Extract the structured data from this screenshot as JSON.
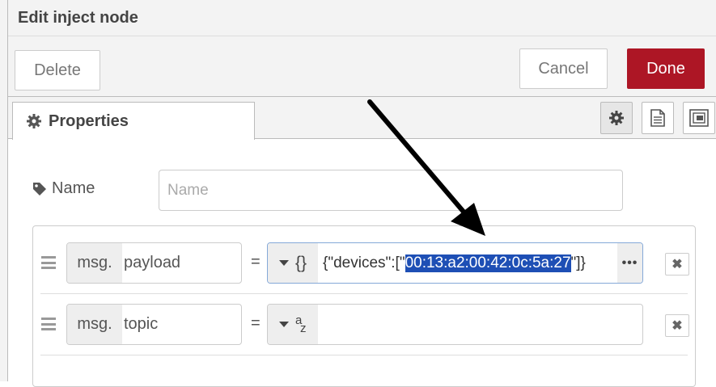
{
  "dialog": {
    "title": "Edit inject node"
  },
  "toolbar": {
    "delete_label": "Delete",
    "cancel_label": "Cancel",
    "done_label": "Done"
  },
  "tabs": {
    "properties_label": "Properties"
  },
  "icons": {
    "properties": "gear-icon",
    "name": "tag-icon",
    "tab_settings": "gear-icon",
    "tab_description": "document-icon",
    "tab_appearance": "layout-icon",
    "grip": "grip-icon",
    "remove": "close-icon",
    "expand": "ellipsis-icon",
    "caret": "caret-down-icon"
  },
  "form": {
    "name_label": "Name",
    "name_placeholder": "Name",
    "name_value": ""
  },
  "properties": [
    {
      "prefix": "msg.",
      "name": "payload",
      "equals": "=",
      "type_glyph": "{}",
      "value_before": "{\"devices\":[\"",
      "value_selected": "00:13:a2:00:42:0c:5a:27",
      "value_after": "\"]}",
      "expand": "•••",
      "remove": "✖"
    },
    {
      "prefix": "msg.",
      "name": "topic",
      "equals": "=",
      "type_glyph_main": "a",
      "type_glyph_sub": "z",
      "value": "",
      "remove": "✖"
    }
  ],
  "colors": {
    "done_bg": "#ad1625",
    "selection_bg": "#1e4fb5",
    "panel_bg": "#f3f3f3",
    "border": "#cccccc"
  }
}
